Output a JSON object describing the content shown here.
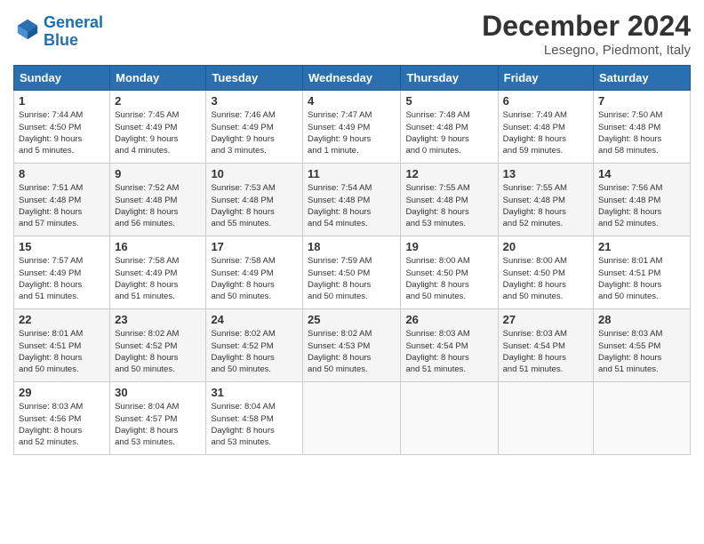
{
  "header": {
    "logo_line1": "General",
    "logo_line2": "Blue",
    "month": "December 2024",
    "location": "Lesegno, Piedmont, Italy"
  },
  "weekdays": [
    "Sunday",
    "Monday",
    "Tuesday",
    "Wednesday",
    "Thursday",
    "Friday",
    "Saturday"
  ],
  "weeks": [
    [
      {
        "day": "1",
        "info": "Sunrise: 7:44 AM\nSunset: 4:50 PM\nDaylight: 9 hours\nand 5 minutes."
      },
      {
        "day": "2",
        "info": "Sunrise: 7:45 AM\nSunset: 4:49 PM\nDaylight: 9 hours\nand 4 minutes."
      },
      {
        "day": "3",
        "info": "Sunrise: 7:46 AM\nSunset: 4:49 PM\nDaylight: 9 hours\nand 3 minutes."
      },
      {
        "day": "4",
        "info": "Sunrise: 7:47 AM\nSunset: 4:49 PM\nDaylight: 9 hours\nand 1 minute."
      },
      {
        "day": "5",
        "info": "Sunrise: 7:48 AM\nSunset: 4:48 PM\nDaylight: 9 hours\nand 0 minutes."
      },
      {
        "day": "6",
        "info": "Sunrise: 7:49 AM\nSunset: 4:48 PM\nDaylight: 8 hours\nand 59 minutes."
      },
      {
        "day": "7",
        "info": "Sunrise: 7:50 AM\nSunset: 4:48 PM\nDaylight: 8 hours\nand 58 minutes."
      }
    ],
    [
      {
        "day": "8",
        "info": "Sunrise: 7:51 AM\nSunset: 4:48 PM\nDaylight: 8 hours\nand 57 minutes."
      },
      {
        "day": "9",
        "info": "Sunrise: 7:52 AM\nSunset: 4:48 PM\nDaylight: 8 hours\nand 56 minutes."
      },
      {
        "day": "10",
        "info": "Sunrise: 7:53 AM\nSunset: 4:48 PM\nDaylight: 8 hours\nand 55 minutes."
      },
      {
        "day": "11",
        "info": "Sunrise: 7:54 AM\nSunset: 4:48 PM\nDaylight: 8 hours\nand 54 minutes."
      },
      {
        "day": "12",
        "info": "Sunrise: 7:55 AM\nSunset: 4:48 PM\nDaylight: 8 hours\nand 53 minutes."
      },
      {
        "day": "13",
        "info": "Sunrise: 7:55 AM\nSunset: 4:48 PM\nDaylight: 8 hours\nand 52 minutes."
      },
      {
        "day": "14",
        "info": "Sunrise: 7:56 AM\nSunset: 4:48 PM\nDaylight: 8 hours\nand 52 minutes."
      }
    ],
    [
      {
        "day": "15",
        "info": "Sunrise: 7:57 AM\nSunset: 4:49 PM\nDaylight: 8 hours\nand 51 minutes."
      },
      {
        "day": "16",
        "info": "Sunrise: 7:58 AM\nSunset: 4:49 PM\nDaylight: 8 hours\nand 51 minutes."
      },
      {
        "day": "17",
        "info": "Sunrise: 7:58 AM\nSunset: 4:49 PM\nDaylight: 8 hours\nand 50 minutes."
      },
      {
        "day": "18",
        "info": "Sunrise: 7:59 AM\nSunset: 4:50 PM\nDaylight: 8 hours\nand 50 minutes."
      },
      {
        "day": "19",
        "info": "Sunrise: 8:00 AM\nSunset: 4:50 PM\nDaylight: 8 hours\nand 50 minutes."
      },
      {
        "day": "20",
        "info": "Sunrise: 8:00 AM\nSunset: 4:50 PM\nDaylight: 8 hours\nand 50 minutes."
      },
      {
        "day": "21",
        "info": "Sunrise: 8:01 AM\nSunset: 4:51 PM\nDaylight: 8 hours\nand 50 minutes."
      }
    ],
    [
      {
        "day": "22",
        "info": "Sunrise: 8:01 AM\nSunset: 4:51 PM\nDaylight: 8 hours\nand 50 minutes."
      },
      {
        "day": "23",
        "info": "Sunrise: 8:02 AM\nSunset: 4:52 PM\nDaylight: 8 hours\nand 50 minutes."
      },
      {
        "day": "24",
        "info": "Sunrise: 8:02 AM\nSunset: 4:52 PM\nDaylight: 8 hours\nand 50 minutes."
      },
      {
        "day": "25",
        "info": "Sunrise: 8:02 AM\nSunset: 4:53 PM\nDaylight: 8 hours\nand 50 minutes."
      },
      {
        "day": "26",
        "info": "Sunrise: 8:03 AM\nSunset: 4:54 PM\nDaylight: 8 hours\nand 51 minutes."
      },
      {
        "day": "27",
        "info": "Sunrise: 8:03 AM\nSunset: 4:54 PM\nDaylight: 8 hours\nand 51 minutes."
      },
      {
        "day": "28",
        "info": "Sunrise: 8:03 AM\nSunset: 4:55 PM\nDaylight: 8 hours\nand 51 minutes."
      }
    ],
    [
      {
        "day": "29",
        "info": "Sunrise: 8:03 AM\nSunset: 4:56 PM\nDaylight: 8 hours\nand 52 minutes."
      },
      {
        "day": "30",
        "info": "Sunrise: 8:04 AM\nSunset: 4:57 PM\nDaylight: 8 hours\nand 53 minutes."
      },
      {
        "day": "31",
        "info": "Sunrise: 8:04 AM\nSunset: 4:58 PM\nDaylight: 8 hours\nand 53 minutes."
      },
      {
        "day": "",
        "info": ""
      },
      {
        "day": "",
        "info": ""
      },
      {
        "day": "",
        "info": ""
      },
      {
        "day": "",
        "info": ""
      }
    ]
  ]
}
